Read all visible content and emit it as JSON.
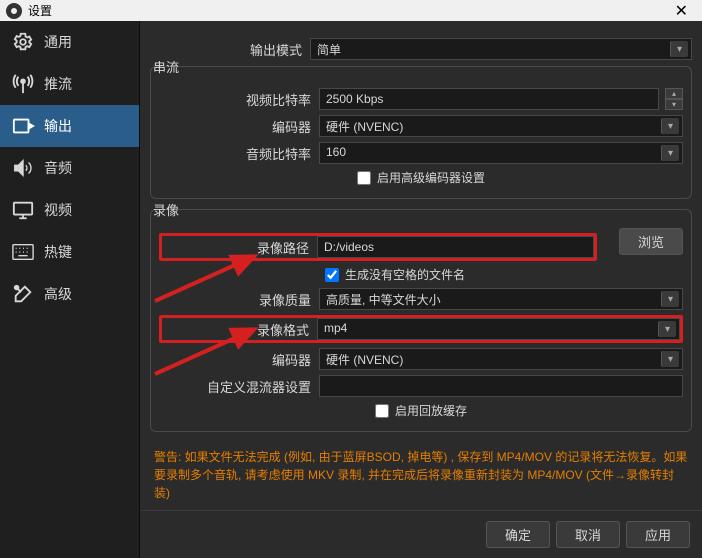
{
  "window": {
    "title": "设置"
  },
  "sidebar": {
    "items": [
      {
        "label": "通用"
      },
      {
        "label": "推流"
      },
      {
        "label": "输出"
      },
      {
        "label": "音频"
      },
      {
        "label": "视频"
      },
      {
        "label": "热键"
      },
      {
        "label": "高级"
      }
    ]
  },
  "output_mode": {
    "label": "输出模式",
    "value": "简单"
  },
  "stream_group": {
    "title": "串流",
    "video_bitrate": {
      "label": "视频比特率",
      "value": "2500 Kbps"
    },
    "encoder": {
      "label": "编码器",
      "value": "硬件 (NVENC)"
    },
    "audio_bitrate": {
      "label": "音频比特率",
      "value": "160"
    },
    "advanced_encoder_checkbox": {
      "label": "启用高级编码器设置"
    }
  },
  "record_group": {
    "title": "录像",
    "recording_path": {
      "label": "录像路径",
      "value": "D:/videos"
    },
    "browse_button": "浏览",
    "generate_no_space": {
      "label": "生成没有空格的文件名"
    },
    "quality": {
      "label": "录像质量",
      "value": "高质量, 中等文件大小"
    },
    "format": {
      "label": "录像格式",
      "value": "mp4"
    },
    "encoder": {
      "label": "编码器",
      "value": "硬件 (NVENC)"
    },
    "muxer": {
      "label": "自定义混流器设置",
      "value": ""
    },
    "replay_buffer": {
      "label": "启用回放缓存"
    }
  },
  "warning": "警告: 如果文件无法完成 (例如, 由于蓝屏BSOD, 掉电等) , 保存到 MP4/MOV 的记录将无法恢复。如果要录制多个音轨, 请考虑使用 MKV 录制, 并在完成后将录像重新封装为 MP4/MOV (文件→录像转封装)",
  "footer": {
    "ok": "确定",
    "cancel": "取消",
    "apply": "应用"
  }
}
